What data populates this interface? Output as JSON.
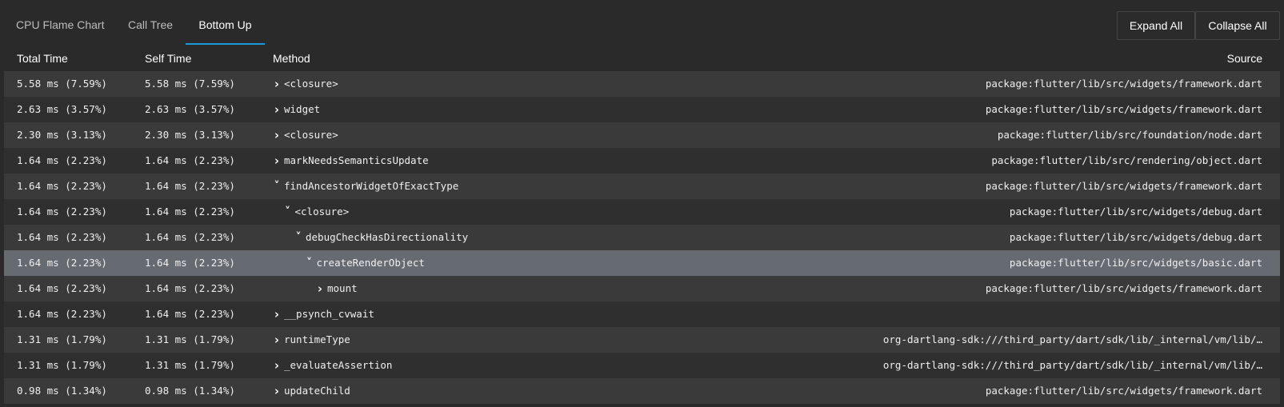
{
  "tabs": [
    {
      "label": "CPU Flame Chart"
    },
    {
      "label": "Call Tree"
    },
    {
      "label": "Bottom Up",
      "active": true
    }
  ],
  "actions": {
    "expand_all": "Expand All",
    "collapse_all": "Collapse All"
  },
  "columns": {
    "total": "Total Time",
    "self": "Self Time",
    "method": "Method",
    "source": "Source"
  },
  "colors": {
    "accent": "#1a9bd7",
    "selected_row": "#666b72"
  },
  "rows": [
    {
      "total": "5.58 ms (7.59%)",
      "self": "5.58 ms (7.59%)",
      "depth": 0,
      "expanded": false,
      "method": "<closure>",
      "source": "package:flutter/lib/src/widgets/framework.dart"
    },
    {
      "total": "2.63 ms (3.57%)",
      "self": "2.63 ms (3.57%)",
      "depth": 0,
      "expanded": false,
      "method": "widget",
      "source": "package:flutter/lib/src/widgets/framework.dart"
    },
    {
      "total": "2.30 ms (3.13%)",
      "self": "2.30 ms (3.13%)",
      "depth": 0,
      "expanded": false,
      "method": "<closure>",
      "source": "package:flutter/lib/src/foundation/node.dart"
    },
    {
      "total": "1.64 ms (2.23%)",
      "self": "1.64 ms (2.23%)",
      "depth": 0,
      "expanded": false,
      "method": "markNeedsSemanticsUpdate",
      "source": "package:flutter/lib/src/rendering/object.dart"
    },
    {
      "total": "1.64 ms (2.23%)",
      "self": "1.64 ms (2.23%)",
      "depth": 0,
      "expanded": true,
      "method": "findAncestorWidgetOfExactType",
      "source": "package:flutter/lib/src/widgets/framework.dart"
    },
    {
      "total": "1.64 ms (2.23%)",
      "self": "1.64 ms (2.23%)",
      "depth": 1,
      "expanded": true,
      "method": "<closure>",
      "source": "package:flutter/lib/src/widgets/debug.dart"
    },
    {
      "total": "1.64 ms (2.23%)",
      "self": "1.64 ms (2.23%)",
      "depth": 2,
      "expanded": true,
      "method": "debugCheckHasDirectionality",
      "source": "package:flutter/lib/src/widgets/debug.dart"
    },
    {
      "total": "1.64 ms (2.23%)",
      "self": "1.64 ms (2.23%)",
      "depth": 3,
      "expanded": true,
      "method": "createRenderObject",
      "source": "package:flutter/lib/src/widgets/basic.dart",
      "selected": true
    },
    {
      "total": "1.64 ms (2.23%)",
      "self": "1.64 ms (2.23%)",
      "depth": 4,
      "expanded": false,
      "method": "mount",
      "source": "package:flutter/lib/src/widgets/framework.dart"
    },
    {
      "total": "1.64 ms (2.23%)",
      "self": "1.64 ms (2.23%)",
      "depth": 0,
      "expanded": false,
      "method": "__psynch_cvwait",
      "source": ""
    },
    {
      "total": "1.31 ms (1.79%)",
      "self": "1.31 ms (1.79%)",
      "depth": 0,
      "expanded": false,
      "method": "runtimeType",
      "source": "org-dartlang-sdk:///third_party/dart/sdk/lib/_internal/vm/lib/…"
    },
    {
      "total": "1.31 ms (1.79%)",
      "self": "1.31 ms (1.79%)",
      "depth": 0,
      "expanded": false,
      "method": "_evaluateAssertion",
      "source": "org-dartlang-sdk:///third_party/dart/sdk/lib/_internal/vm/lib/…"
    },
    {
      "total": "0.98 ms (1.34%)",
      "self": "0.98 ms (1.34%)",
      "depth": 0,
      "expanded": false,
      "method": "updateChild",
      "source": "package:flutter/lib/src/widgets/framework.dart"
    }
  ]
}
